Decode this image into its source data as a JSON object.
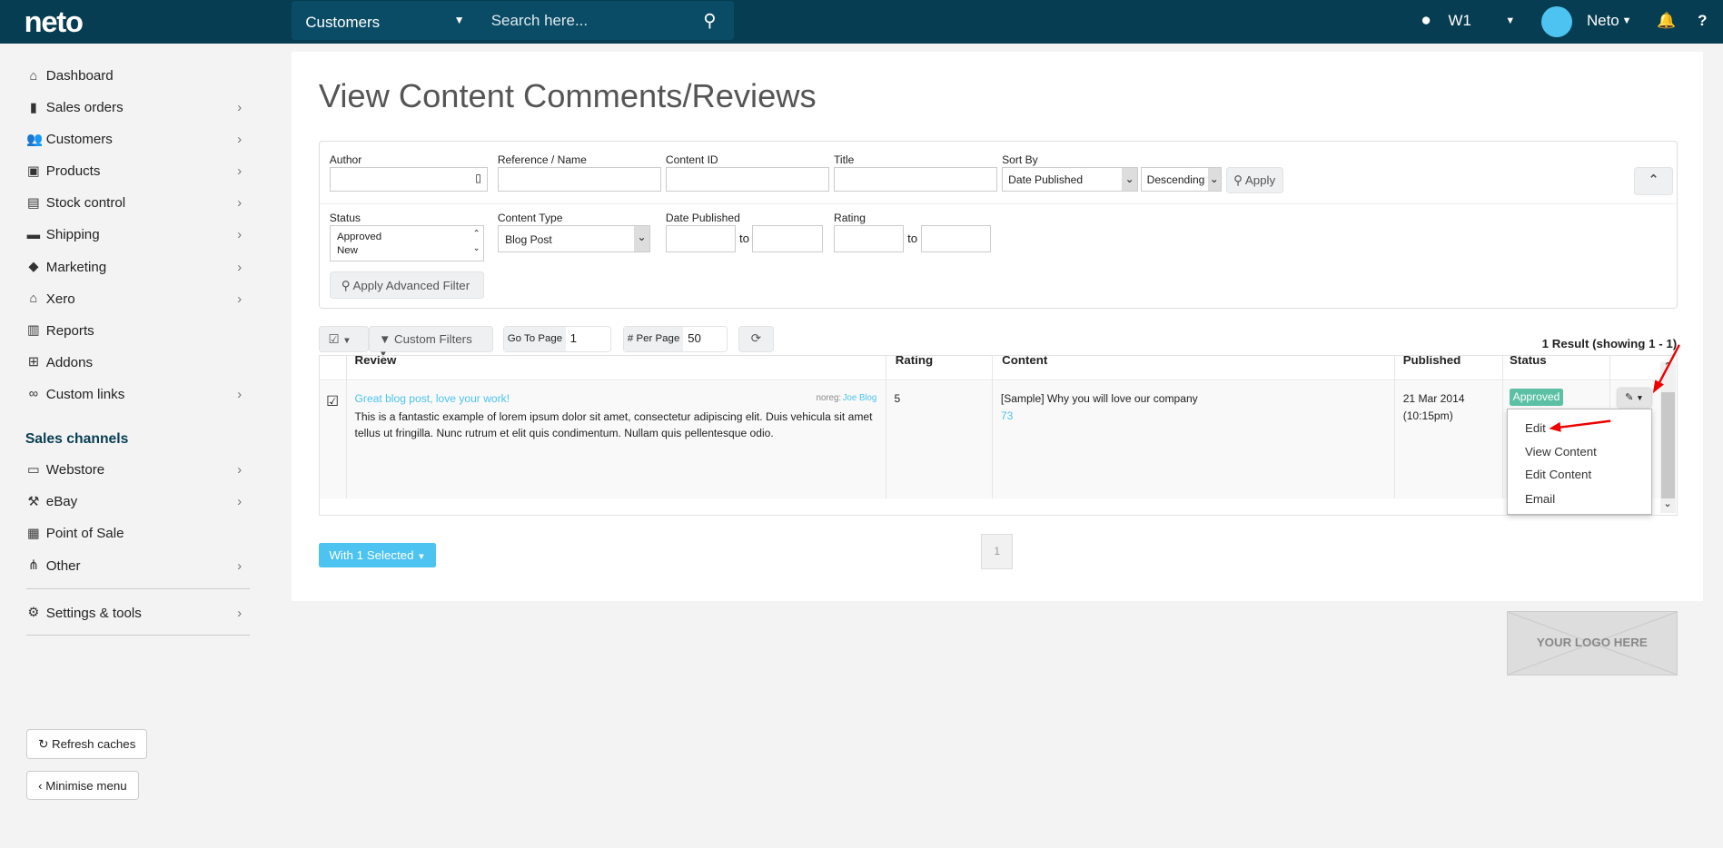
{
  "topbar": {
    "logo": "neto",
    "search_scope": "Customers",
    "search_placeholder": "Search here...",
    "location": "W1",
    "user": "Neto"
  },
  "sidebar": {
    "items": [
      {
        "label": "Dashboard",
        "icon": "home-icon"
      },
      {
        "label": "Sales orders",
        "icon": "file-icon"
      },
      {
        "label": "Customers",
        "icon": "users-icon"
      },
      {
        "label": "Products",
        "icon": "gift-icon"
      },
      {
        "label": "Stock control",
        "icon": "clipboard-check-icon"
      },
      {
        "label": "Shipping",
        "icon": "truck-icon"
      },
      {
        "label": "Marketing",
        "icon": "tag-icon"
      },
      {
        "label": "Xero",
        "icon": "bank-icon"
      },
      {
        "label": "Reports",
        "icon": "bar-chart-icon"
      },
      {
        "label": "Addons",
        "icon": "plus-square-icon"
      },
      {
        "label": "Custom links",
        "icon": "link-icon"
      }
    ],
    "channels_heading": "Sales channels",
    "channels": [
      {
        "label": "Webstore",
        "icon": "browser-icon"
      },
      {
        "label": "eBay",
        "icon": "gavel-icon"
      },
      {
        "label": "Point of Sale",
        "icon": "store-icon"
      },
      {
        "label": "Other",
        "icon": "network-icon"
      }
    ],
    "settings": "Settings & tools",
    "refresh": "Refresh caches",
    "minimise": "Minimise menu"
  },
  "page": {
    "title": "View Content Comments/Reviews"
  },
  "filters": {
    "author": "Author",
    "reference": "Reference / Name",
    "content_id": "Content ID",
    "title": "Title",
    "sort_by": "Sort By",
    "sort_value": "Date Published",
    "sort_dir": "Descending",
    "apply": "Apply",
    "status": "Status",
    "status_options": [
      "Approved",
      "New"
    ],
    "content_type": "Content Type",
    "content_type_value": "Blog Post",
    "date_published": "Date Published",
    "rating": "Rating",
    "to": "to",
    "apply_advanced": "Apply Advanced Filter"
  },
  "toolbar": {
    "custom_filters": "Custom Filters",
    "go_to_page": "Go To Page",
    "page_value": "1",
    "per_page": "# Per Page",
    "per_page_value": "50",
    "result": "1 Result (showing 1 - 1)"
  },
  "table": {
    "headers": [
      "Review",
      "Rating",
      "Content",
      "Published",
      "Status"
    ],
    "row": {
      "review_title": "Great blog post, love your work!",
      "noreg": "noreg:",
      "author": "Joe Blog",
      "review_text": "This is a fantastic example of lorem ipsum dolor sit amet, consectetur adipiscing elit. Duis vehicula sit amet tellus ut fringilla. Nunc rutrum et elit quis condimentum. Nullam quis pellentesque odio.",
      "rating": "5",
      "content": "[Sample] Why you will love our company",
      "content_id": "73",
      "published_date": "21 Mar 2014",
      "published_time": "(10:15pm)",
      "status": "Approved"
    }
  },
  "menu": [
    "Edit",
    "View Content",
    "Edit Content",
    "Email"
  ],
  "bottom": {
    "with_selected": "With 1 Selected",
    "page": "1",
    "logo_placeholder": "YOUR LOGO HERE"
  },
  "colors": {
    "topbar": "#073d52",
    "accent": "#4cc3f0",
    "approved": "#5bc0a4"
  }
}
